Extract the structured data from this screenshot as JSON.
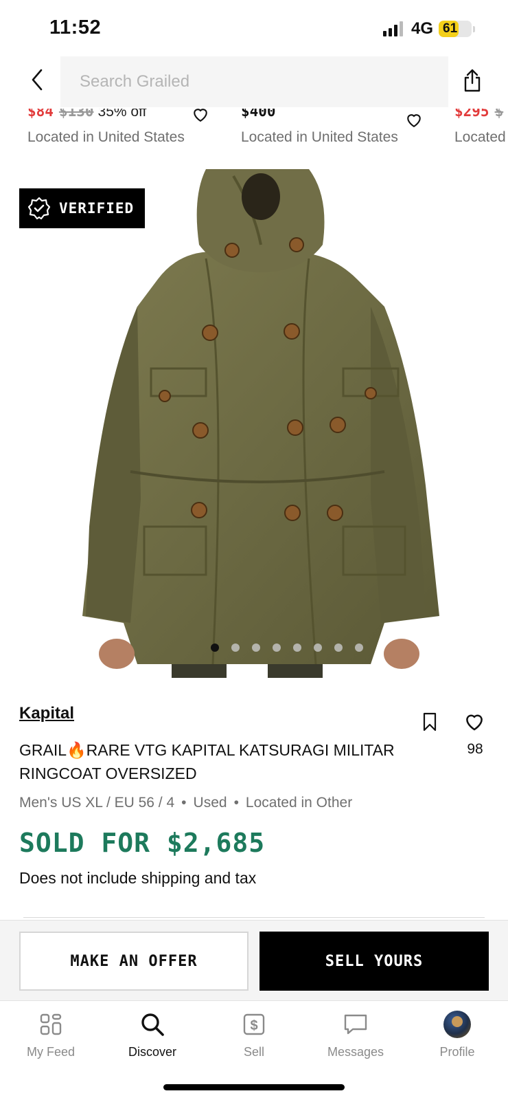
{
  "status_bar": {
    "time": "11:52",
    "network": "4G",
    "battery": "61",
    "battery_level_percent": 61
  },
  "search": {
    "placeholder": "Search Grailed"
  },
  "related": [
    {
      "sale_price": "$84",
      "original_price": "$130",
      "discount": "35% off",
      "location": "Located in United States"
    },
    {
      "price_partial": "$400",
      "location": "Located in United States"
    },
    {
      "sale_price": "$295",
      "original_price": "$",
      "location": "Located"
    }
  ],
  "product": {
    "verified_label": "VERIFIED",
    "brand": "Kapital",
    "title": "GRAIL🔥RARE VTG KAPITAL KATSURAGI MILITAR RINGCOAT OVERSIZED",
    "likes": "98",
    "size": "Men's US XL / EU 56 / 4",
    "condition": "Used",
    "location": "Located in Other",
    "sold_label": "SOLD FOR $2,685",
    "shipping_note": "Does not include shipping and tax",
    "image_count": 8,
    "active_image_index": 0
  },
  "actions": {
    "offer_label": "MAKE AN OFFER",
    "sell_label": "SELL YOURS"
  },
  "tabs": [
    {
      "label": "My Feed",
      "icon": "grid-icon"
    },
    {
      "label": "Discover",
      "icon": "search-icon"
    },
    {
      "label": "Sell",
      "icon": "dollar-tag-icon"
    },
    {
      "label": "Messages",
      "icon": "chat-bubble-icon"
    },
    {
      "label": "Profile",
      "icon": "avatar"
    }
  ],
  "colors": {
    "sale_red": "#e23b3b",
    "sold_green": "#1d7a5c",
    "battery_yellow": "#f4cf1a"
  }
}
